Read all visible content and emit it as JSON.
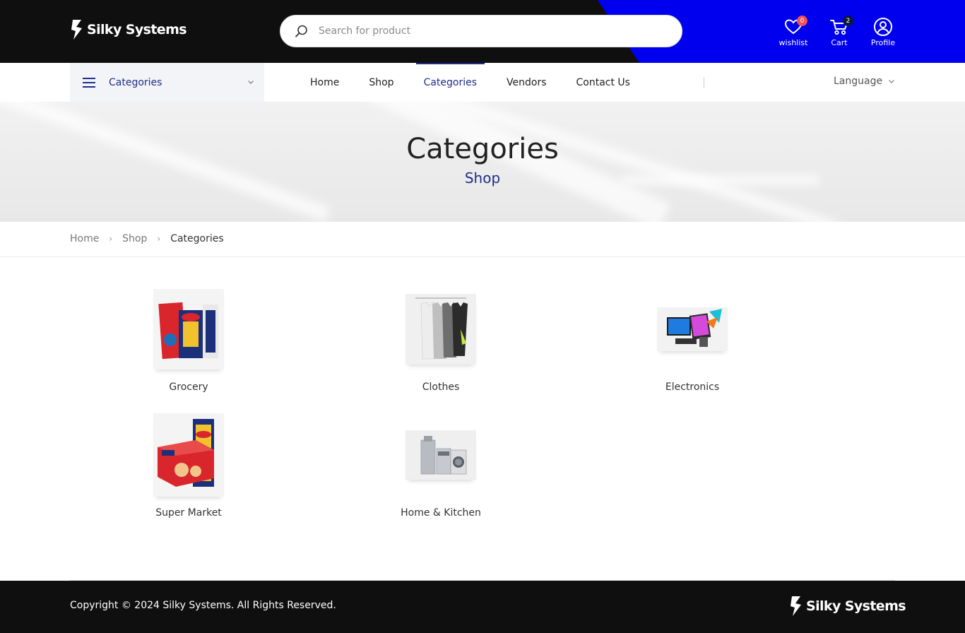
{
  "brand": {
    "name": "Silky Systems"
  },
  "search": {
    "placeholder": "Search for product"
  },
  "header_actions": {
    "wishlist": {
      "label": "wishlist",
      "count": "0"
    },
    "cart": {
      "label": "Cart",
      "count": "2"
    },
    "profile": {
      "label": "Profile"
    }
  },
  "nav": {
    "categories_dropdown": "Categories",
    "links": [
      "Home",
      "Shop",
      "Categories",
      "Vendors",
      "Contact Us"
    ],
    "active": "Categories",
    "language": "Language"
  },
  "hero": {
    "title": "Categories",
    "subtitle": "Shop"
  },
  "breadcrumb": [
    "Home",
    "Shop",
    "Categories"
  ],
  "categories": [
    {
      "name": "Grocery",
      "icon": "grocery-image"
    },
    {
      "name": "Clothes",
      "icon": "clothes-image"
    },
    {
      "name": "Electronics",
      "icon": "electronics-image"
    },
    {
      "name": "Super Market",
      "icon": "super-market-image"
    },
    {
      "name": "Home & Kitchen",
      "icon": "home-kitchen-image"
    }
  ],
  "footer": {
    "copyright": "Copyright © 2024 Silky Systems. All Rights Reserved."
  },
  "colors": {
    "accent": "#1e2d8c",
    "header_bg": "#0f0f0f",
    "header_blue": "#0000ee",
    "badge_red": "#f0515b"
  }
}
